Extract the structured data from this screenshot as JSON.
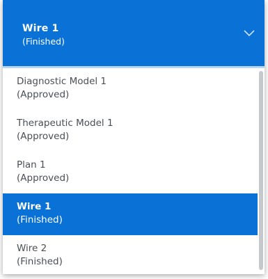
{
  "dropdown": {
    "selected": {
      "title": "Wire 1",
      "status": "(Finished)"
    },
    "chevron_icon": "chevron-down-icon",
    "options": [
      {
        "name": "Diagnostic Model 1",
        "status": "(Approved)",
        "selected": false
      },
      {
        "name": "Therapeutic Model 1",
        "status": "(Approved)",
        "selected": false
      },
      {
        "name": "Plan 1",
        "status": "(Approved)",
        "selected": false
      },
      {
        "name": "Wire 1",
        "status": "(Finished)",
        "selected": true
      },
      {
        "name": "Wire 2",
        "status": "(Finished)",
        "selected": false
      }
    ]
  },
  "colors": {
    "accent": "#0a72d6",
    "text": "#4a4f55",
    "divider": "#dfe3e8"
  }
}
